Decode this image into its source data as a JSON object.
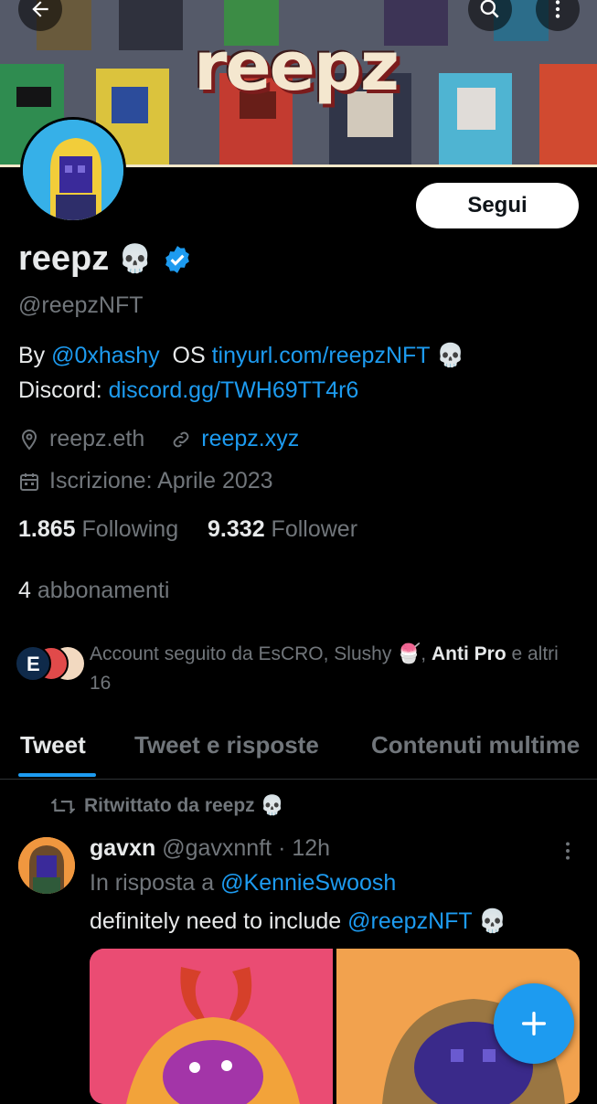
{
  "banner": {
    "logo": "reepz"
  },
  "profile": {
    "name": "reepz",
    "name_emoji": "💀",
    "handle": "@reepzNFT",
    "follow_label": "Segui",
    "bio": {
      "line1_prefix": "By ",
      "line1_mention": "@0xhashy",
      "line1_mid": "  OS ",
      "line1_link": "tinyurl.com/reepzNFT",
      "line1_emoji": " 💀",
      "line2_prefix": "Discord: ",
      "line2_link": "discord.gg/TWH69TT4r6"
    },
    "location": "reepz.eth",
    "website": "reepz.xyz",
    "joined": "Iscrizione: Aprile 2023",
    "following_count": "1.865",
    "following_label": "Following",
    "followers_count": "9.332",
    "followers_label": "Follower",
    "subs_count": "4",
    "subs_label": "abbonamenti",
    "followed_by_text": "Account seguito da EsCRO, Slushy 🍧, ",
    "followed_by_bold": "Anti Pro",
    "followed_by_rest": " e altri 16"
  },
  "tabs": [
    "Tweet",
    "Tweet e risposte",
    "Contenuti multime"
  ],
  "tweet": {
    "retweeted_by": "Ritwittato da reepz 💀",
    "author_name": "gavxn",
    "author_handle": "@gavxnnft",
    "time": "· 12h",
    "reply_prefix": "In risposta a ",
    "reply_to": "@KennieSwoosh",
    "text_prefix": "definitely need to include ",
    "text_mention": "@reepzNFT",
    "text_emoji": " 💀"
  },
  "colors": {
    "accent": "#1d9bf0",
    "background": "#000000"
  },
  "icons": [
    "back-arrow-icon",
    "search-icon",
    "more-icon",
    "verified-badge-icon",
    "location-icon",
    "link-icon",
    "calendar-icon",
    "retweet-icon",
    "compose-plus-icon"
  ]
}
